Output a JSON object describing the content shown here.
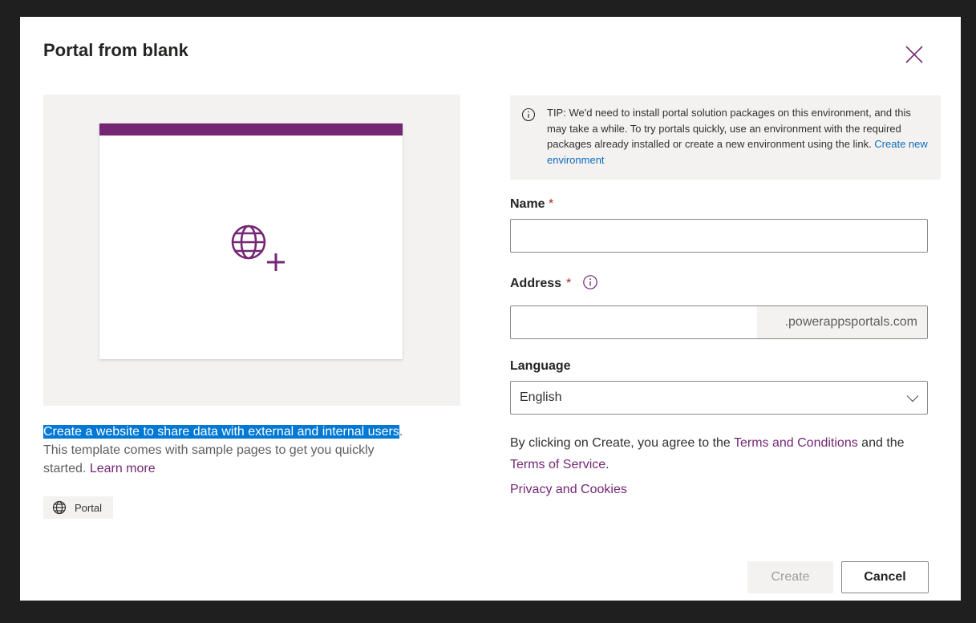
{
  "dialog": {
    "title": "Portal from blank",
    "description": {
      "selected_text": "Create a website to share data with external and internal users",
      "rest_text": ". This template comes with sample pages to get you quickly started. ",
      "learn_more": "Learn more"
    },
    "tag": {
      "label": "Portal",
      "icon": "globe-icon"
    }
  },
  "tip": {
    "text": "TIP: We'd need to install portal solution packages on this environment, and this may take a while. To try portals quickly, use an environment with the required packages already installed or create a new environment using the link. ",
    "link": "Create new environment"
  },
  "form": {
    "name_label": "Name",
    "name_value": "",
    "address_label": "Address",
    "address_value": "",
    "address_suffix": ".powerappsportals.com",
    "language_label": "Language",
    "language_value": "English",
    "required_marker": "*"
  },
  "legal": {
    "prefix": "By clicking on Create, you agree to the ",
    "terms_conditions": "Terms and Conditions",
    "middle": " and the ",
    "terms_service": "Terms of Service",
    "suffix": ".",
    "privacy": "Privacy and Cookies"
  },
  "buttons": {
    "create": "Create",
    "cancel": "Cancel"
  },
  "colors": {
    "accent": "#742774",
    "selection": "#0078d4",
    "link_blue": "#0f6cbd"
  }
}
